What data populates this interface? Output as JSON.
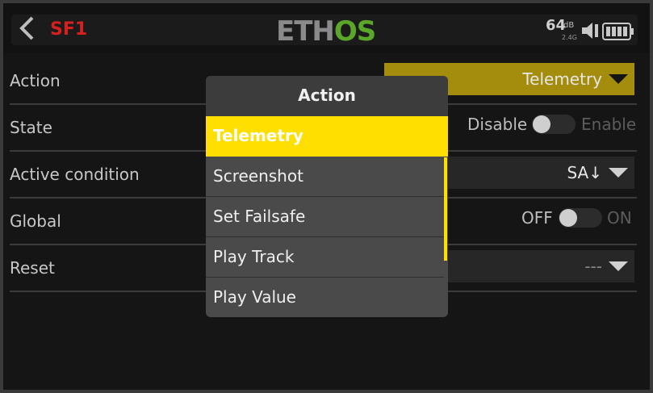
{
  "header": {
    "back_icon": "chevron-left-icon",
    "title": "SF1",
    "logo_part1": "ETH",
    "logo_part2": "OS",
    "rssi_value": "64",
    "rssi_unit": "dB",
    "rssi_band": "2.4G",
    "speaker_icon": "speaker-icon",
    "battery_icon": "battery-icon"
  },
  "rows": {
    "action": {
      "label": "Action",
      "value": "Telemetry"
    },
    "state": {
      "label": "State",
      "off_label": "Disable",
      "on_label": "Enable"
    },
    "active_condition": {
      "label": "Active condition",
      "value": "SA↓"
    },
    "global": {
      "label": "Global",
      "off_label": "OFF",
      "on_label": "ON"
    },
    "reset": {
      "label": "Reset",
      "value": "---"
    }
  },
  "popup": {
    "title": "Action",
    "items": [
      "Telemetry",
      "Screenshot",
      "Set Failsafe",
      "Play Track",
      "Play Value"
    ],
    "selected_index": 0
  },
  "colors": {
    "accent_yellow": "#ffdf00",
    "dropdown_yellow": "#a48c0c",
    "title_red": "#d62020",
    "logo_green": "#5aa72a"
  }
}
